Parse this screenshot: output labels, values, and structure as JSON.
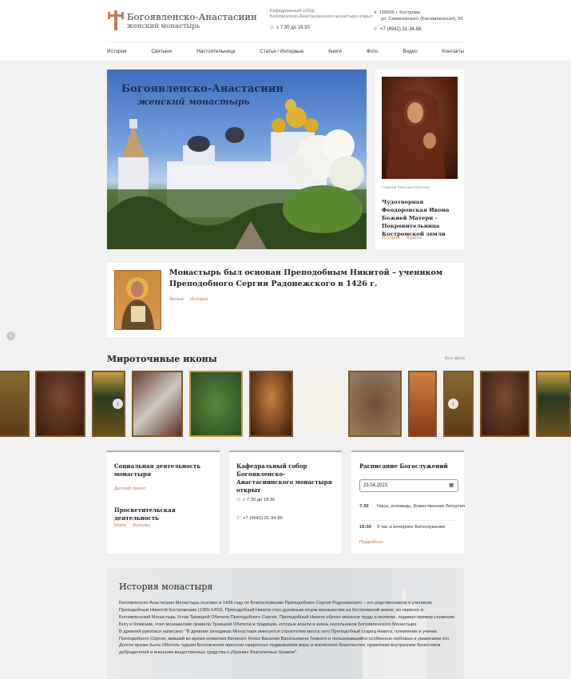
{
  "header": {
    "logo_line1": "Богоявленско-Анастасиин",
    "logo_line2": "женский монастырь",
    "cathedral_line1": "Кафедральный собор",
    "cathedral_line2": "Богоявленско-Анастасиинского монастыря открыт",
    "hours": "с 7:30 до 18:30",
    "address_line1": "156000 г. Кострома",
    "address_line2": "ул. Симановского (Богоявленская), 26",
    "phone": "+7 (4942) 31-34-86"
  },
  "nav": [
    "История",
    "Святыни",
    "Настоятельница",
    "Статьи / Интервью",
    "Книги",
    "Фото",
    "Видео",
    "Контакты"
  ],
  "hero": {
    "title_line1": "Богоявленско-Анастасиин",
    "title_line2": "женский монастырь"
  },
  "sidebar": {
    "caption": "Главная Святыня Обители",
    "title": "Чудотворная Феодоровская Икона Божией Матери – Покровительница Костромской земли",
    "tags": [
      "История",
      "Чудеса"
    ]
  },
  "founder": {
    "title": "Монастырь был основан Преподобным Никитой – учеником Преподобного Сергия Радонежского в 1426 г.",
    "tags": [
      "Фильм",
      "История"
    ]
  },
  "icons_section": {
    "title": "Мироточивые иконы",
    "all_photos": "Все фото"
  },
  "social_card": {
    "title": "Социальная деятельность монастыря",
    "link": "Детский приют",
    "title2": "Просветительская деятельность",
    "links2": [
      "Книги",
      "Фильмы"
    ]
  },
  "cathedral_card": {
    "title": "Кафедральный собор Богоявленско-Анастасиинского монастыря открыт",
    "hours": "с 7:30 до 18:30",
    "phone": "+7 (4942) 31-34-86"
  },
  "schedule_card": {
    "title": "Расписание Богослужений",
    "date_value": "23.04.2023",
    "items": [
      {
        "time": "7:30",
        "desc": "Часы, исповедь, Божественная Литургия"
      },
      {
        "time": "16:30",
        "desc": "9 час и вечернее Богослужение"
      }
    ],
    "more": "Подробнее"
  },
  "history": {
    "title": "История монастыря",
    "p1": "Богоявленско-Анастасиин Монастырь основан в 1426 году по Благословению Преподобного Сергия Радонежского – его родственником и учеником Преподобным Никитой Костромским (1365-1450). Преподобный Никита стал духовным отцом монашества на Костромской земле, он перенес в Богоявленский Монастырь Устав Троицкой Обители Преподобного Сергия. Преподобный Никита обучал монахов труду и молитве, подавал пример служения Богу и ближним, чтил монашеские правила Троицкой Обители и традиции, которые вошли в жизнь насельников Богоявленского Монастыря.",
    "p2": "В древней рукописи написано: \"В древних синодиках Монастыря именуется строителем места сего Преподобный старец Никита, племянник и ученик Преподобного Сергия, живший во время княжения Великого Князя Василия Васильевича Темного и пользовавшийся особенною любовью и уважением его. Долгое время была Обитель чудная Богоявления приютом смиренных подвижников веры и иноческого благочестия, привлекая внутренним богатством добродетелей и внешним вещественных средства к убранию благолепных Храмов\"."
  },
  "colors": {
    "accent": "#b5815e",
    "card_border": "#c4a58c"
  }
}
